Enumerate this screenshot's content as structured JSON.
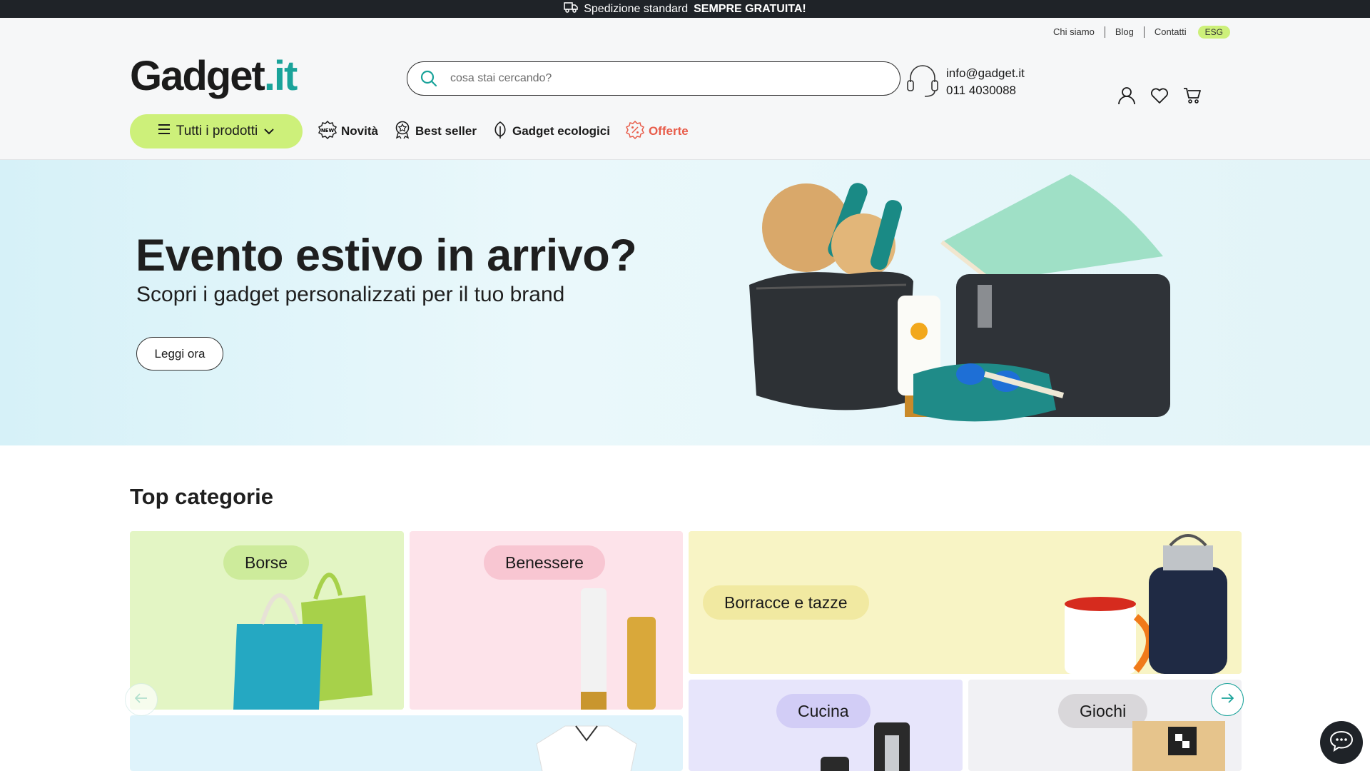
{
  "topbar": {
    "text": "Spedizione standard",
    "highlight": "SEMPRE GRATUITA!",
    "icon": "truck-icon"
  },
  "utility_links": {
    "about": "Chi siamo",
    "blog": "Blog",
    "contact": "Contatti",
    "esg": "ESG"
  },
  "logo": {
    "main": "Gadget",
    "suffix": ".it"
  },
  "search": {
    "placeholder": "cosa stai cercando?"
  },
  "contact": {
    "email": "info@gadget.it",
    "phone": "011 4030088"
  },
  "nav": {
    "all_products": "Tutti i prodotti",
    "items": [
      {
        "label": "Novità",
        "icon": "new-badge-icon"
      },
      {
        "label": "Best seller",
        "icon": "award-icon"
      },
      {
        "label": "Gadget ecologici",
        "icon": "leaf-icon"
      },
      {
        "label": "Offerte",
        "icon": "discount-icon"
      }
    ]
  },
  "hero": {
    "title": "Evento estivo in arrivo?",
    "subtitle": "Scopri i gadget personalizzati per il tuo brand",
    "button": "Leggi ora"
  },
  "top_categories": {
    "title": "Top categorie",
    "items": [
      {
        "label": "Borse",
        "color": "#e3f5c4"
      },
      {
        "label": "Benessere",
        "color": "#fde3ea"
      },
      {
        "label": "Borracce e tazze",
        "color": "#f8f4c5"
      },
      {
        "label": "Cucina",
        "color": "#e7e5fb"
      },
      {
        "label": "Giochi",
        "color": "#f1f1f4"
      }
    ]
  },
  "colors": {
    "accent": "#cdf07a",
    "brand_teal": "#1aa39a",
    "offer_red": "#e85c4a",
    "dark": "#1f2328"
  }
}
